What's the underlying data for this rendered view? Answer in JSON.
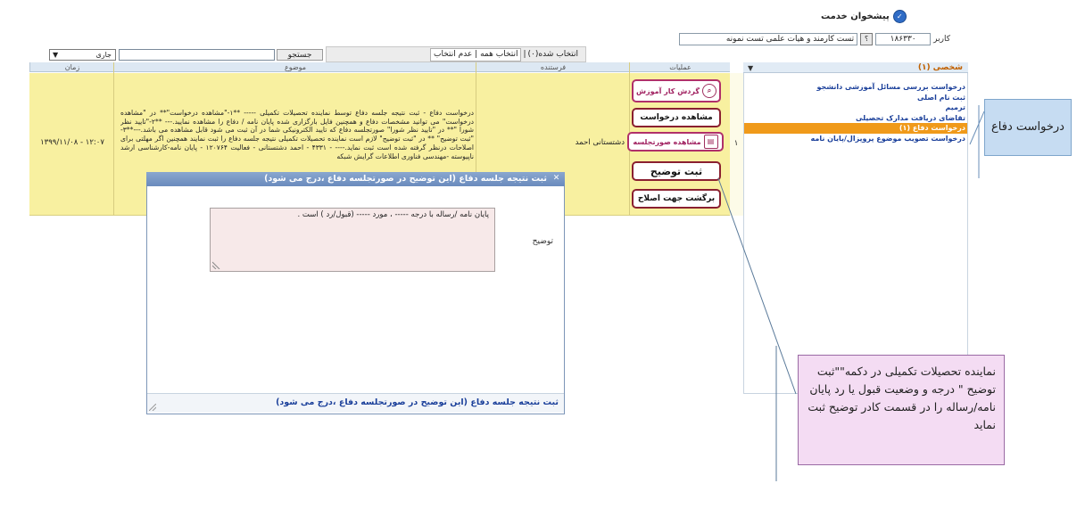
{
  "header": {
    "title": "پیشخوان خدمت"
  },
  "user": {
    "label": "کاربر",
    "id": "۱۸۶۳۳۰",
    "help": "؟",
    "name": "تست کارمند و هیات علمی تست نمونه"
  },
  "right_panel": {
    "header": "شخصی (۱)",
    "items": [
      "درخواست بررسی مسائل آموزشی دانشجو",
      "ثبت نام اصلی",
      "ترمیم",
      "تقاضای دریافت مدارک تحصیلی",
      "درخواست دفاع (۱)",
      "درخواست تصویب موضوع پروپزال/پایان نامه"
    ]
  },
  "toolbar": {
    "select_value": "جاری",
    "search_button": "جستجو",
    "selected": "انتخاب شده(۰)",
    "sep": "|",
    "select_all": "انتخاب همه",
    "deselect": "عدم انتخاب"
  },
  "table": {
    "headers": {
      "time": "زمان",
      "subject": "موضوع",
      "sender": "فرستنده",
      "ops": "عملیات"
    },
    "row": {
      "time": "۱۳۹۹/۱۱/۰۸ - ۱۲:۰۷",
      "subject": "درخواست دفاع - ثبت نتیجه جلسه دفاع توسط نماینده تحصیلات تکمیلی ----- **۱-\"مشاهده درخواست\"** در \"مشاهده درخواست\" می توانید مشخصات دفاع و همچنین فایل بارگزاری شده پایان نامه / دفاع را مشاهده نمایید.--- **۲-\"تایید نظر شورا \"** در \"تایید نظر شورا\" صورتجلسه دفاع که تایید الکترونیکی شما در آن ثبت می شود قابل مشاهده می باشد.---**۳-\"ثبت توضیح\" ** در \"ثبت توضیح\" لازم است نماینده تحصیلات تکمیلی نتیجه جلسه دفاع را ثبت نمایند همچنین اگر مهلتی برای اصلاحات درنظر گرفته شده است ثبت نماید.---- - ۴۳۳۱ - احمد دشتستانی - فعالیت ۱۲۰۷۶۴ - پایان نامه-کارشناسی ارشد ناپیوسته -مهندسی فناوری اطلاعات گرایش شبکه",
      "sender": "دشتستانی احمد",
      "num": "۱"
    }
  },
  "actions": {
    "workflow": "گردش کار آموزش",
    "view_request": "مشاهده درخواست",
    "view_minutes": "مشاهده صورتجلسه",
    "register": "ثبت توضیح",
    "return": "برگشت جهت اصلاح"
  },
  "dialog": {
    "title": "ثبت نتیجه جلسه دفاع (این توضیح در صورتجلسه دفاع ،درج می شود)",
    "textarea": "پایان نامه /رساله با درجه ----- ، مورد ----- (قبول/رد ) است .",
    "label": "توضیح",
    "footer": "ثبت نتیجه جلسه دفاع (این توضیح در صورتجلسه دفاع ،درج می شود)"
  },
  "callouts": {
    "defense": "درخواست دفاع",
    "note": "نماینده تحصیلات تکمیلی در دکمه\"\"ثبت توضیح \" درجه و وضعیت قبول یا رد پایان نامه/رساله را در قسمت کادر توضیح ثبت نماید"
  }
}
